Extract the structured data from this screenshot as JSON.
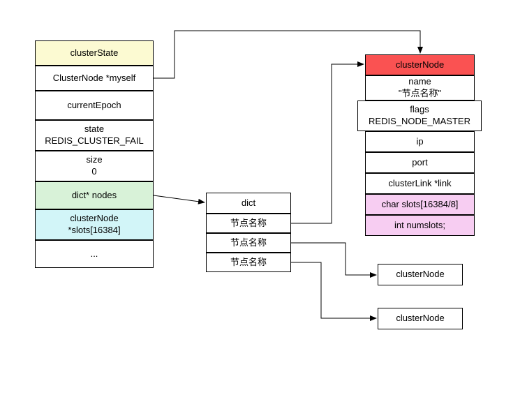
{
  "clusterState": {
    "header": "clusterState",
    "rows": {
      "myself": "ClusterNode *myself",
      "currentEpoch": "currentEpoch",
      "state_label": "state",
      "state_value": "REDIS_CLUSTER_FAIL",
      "size_label": "size",
      "size_value": "0",
      "nodes": "dict* nodes",
      "slots_label": "clusterNode",
      "slots_value": "*slots[16384]",
      "ellipsis": "..."
    }
  },
  "dict": {
    "header": "dict",
    "entries": [
      "节点名称",
      "节点名称",
      "节点名称"
    ]
  },
  "clusterNode": {
    "header": "clusterNode",
    "name_label": "name",
    "name_value": "\"节点名称\"",
    "flags_label": "flags",
    "flags_value": "REDIS_NODE_MASTER",
    "ip": "ip",
    "port": "port",
    "link": "clusterLink *link",
    "char_slots": "char slots[16384/8]",
    "numslots": "int numslots;"
  },
  "refs": {
    "node2": "clusterNode",
    "node3": "clusterNode"
  }
}
